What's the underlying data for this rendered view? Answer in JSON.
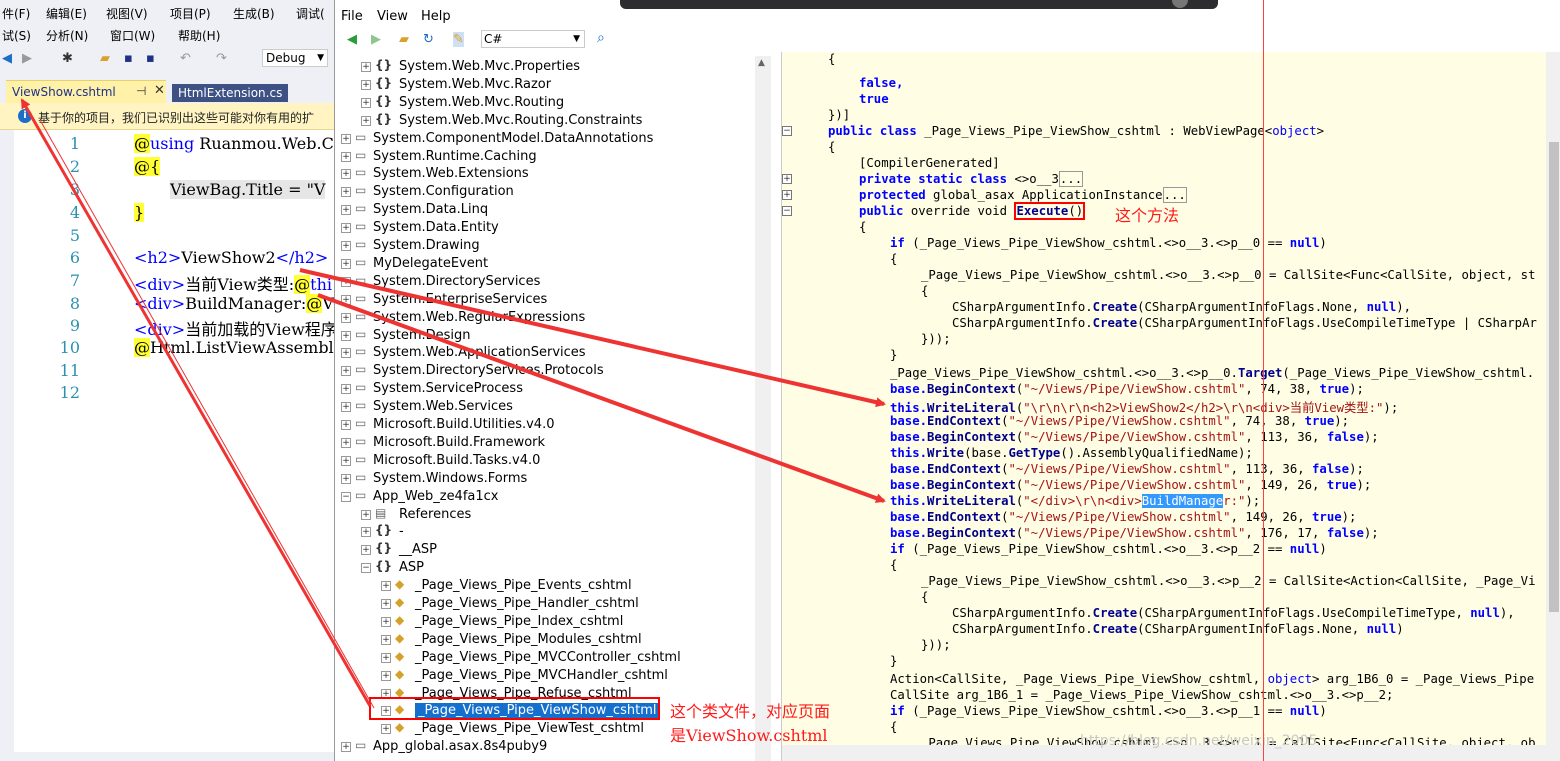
{
  "vs": {
    "menu_row1": [
      "件(F)",
      "编辑(E)",
      "视图(V)",
      "项目(P)",
      "生成(B)",
      "调试("
    ],
    "menu_row2": [
      "试(S)",
      "分析(N)",
      "窗口(W)",
      "帮助(H)"
    ],
    "config": "Debug",
    "tabs": [
      {
        "label": "ViewShow.cshtml",
        "active": true
      },
      {
        "label": "HtmlExtension.cs",
        "active": false
      }
    ],
    "infobar_text": "基于你的项目，我们已识别出这些可能对你有用的扩",
    "line_numbers": [
      "1",
      "2",
      "3",
      "4",
      "5",
      "6",
      "7",
      "8",
      "9",
      "10",
      "11",
      "12"
    ],
    "code": {
      "l1a": "@",
      "l1b": "using",
      "l1c": " Ruanmou.Web.Cor",
      "l2a": "@",
      "l2b": "{",
      "l3": "ViewBag.Title = \"V",
      "l4": "}",
      "l6a": "<h2>",
      "l6b": "ViewShow2",
      "l6c": "</h2>",
      "l7a": "<div>",
      "l7b": "当前View类型:",
      "l7c": "@",
      "l7d": "thi",
      "l8a": "<div>",
      "l8b": "BuildManager:",
      "l8c": "@",
      "l8d": "Vie",
      "l9a": "<div>",
      "l9b": "当前加载的View程序",
      "l10a": "@",
      "l10b": "Html.ListViewAssembli"
    }
  },
  "decompiler": {
    "menu": [
      "File",
      "View",
      "Help"
    ],
    "language": "C#",
    "tree": [
      {
        "label": "System.Web.Mvc.Properties",
        "indent": 1,
        "icon": "{}"
      },
      {
        "label": "System.Web.Mvc.Razor",
        "indent": 1,
        "icon": "{}"
      },
      {
        "label": "System.Web.Mvc.Routing",
        "indent": 1,
        "icon": "{}"
      },
      {
        "label": "System.Web.Mvc.Routing.Constraints",
        "indent": 1,
        "icon": "{}"
      },
      {
        "label": "System.ComponentModel.DataAnnotations",
        "indent": 0,
        "icon": "asm"
      },
      {
        "label": "System.Runtime.Caching",
        "indent": 0,
        "icon": "asm"
      },
      {
        "label": "System.Web.Extensions",
        "indent": 0,
        "icon": "asm"
      },
      {
        "label": "System.Configuration",
        "indent": 0,
        "icon": "asm"
      },
      {
        "label": "System.Data.Linq",
        "indent": 0,
        "icon": "asm"
      },
      {
        "label": "System.Data.Entity",
        "indent": 0,
        "icon": "asm"
      },
      {
        "label": "System.Drawing",
        "indent": 0,
        "icon": "asm"
      },
      {
        "label": "MyDelegateEvent",
        "indent": 0,
        "icon": "asm"
      },
      {
        "label": "System.DirectoryServices",
        "indent": 0,
        "icon": "asm"
      },
      {
        "label": "System.EnterpriseServices",
        "indent": 0,
        "icon": "asm"
      },
      {
        "label": "System.Web.RegularExpressions",
        "indent": 0,
        "icon": "asm"
      },
      {
        "label": "System.Design",
        "indent": 0,
        "icon": "asm"
      },
      {
        "label": "System.Web.ApplicationServices",
        "indent": 0,
        "icon": "asm"
      },
      {
        "label": "System.DirectoryServices.Protocols",
        "indent": 0,
        "icon": "asm"
      },
      {
        "label": "System.ServiceProcess",
        "indent": 0,
        "icon": "asm"
      },
      {
        "label": "System.Web.Services",
        "indent": 0,
        "icon": "asm"
      },
      {
        "label": "Microsoft.Build.Utilities.v4.0",
        "indent": 0,
        "icon": "asm"
      },
      {
        "label": "Microsoft.Build.Framework",
        "indent": 0,
        "icon": "asm"
      },
      {
        "label": "Microsoft.Build.Tasks.v4.0",
        "indent": 0,
        "icon": "asm"
      },
      {
        "label": "System.Windows.Forms",
        "indent": 0,
        "icon": "asm"
      },
      {
        "label": "App_Web_ze4fa1cx",
        "indent": 0,
        "icon": "asm",
        "expanded": true
      },
      {
        "label": "References",
        "indent": 1,
        "icon": "ref"
      },
      {
        "label": "-",
        "indent": 1,
        "icon": "{}"
      },
      {
        "label": "__ASP",
        "indent": 1,
        "icon": "{}"
      },
      {
        "label": "ASP",
        "indent": 1,
        "icon": "{}",
        "expanded": true
      },
      {
        "label": "_Page_Views_Pipe_Events_cshtml",
        "indent": 2,
        "icon": "cls"
      },
      {
        "label": "_Page_Views_Pipe_Handler_cshtml",
        "indent": 2,
        "icon": "cls"
      },
      {
        "label": "_Page_Views_Pipe_Index_cshtml",
        "indent": 2,
        "icon": "cls"
      },
      {
        "label": "_Page_Views_Pipe_Modules_cshtml",
        "indent": 2,
        "icon": "cls"
      },
      {
        "label": "_Page_Views_Pipe_MVCController_cshtml",
        "indent": 2,
        "icon": "cls"
      },
      {
        "label": "_Page_Views_Pipe_MVCHandler_cshtml",
        "indent": 2,
        "icon": "cls"
      },
      {
        "label": "_Page_Views_Pipe_Refuse_cshtml",
        "indent": 2,
        "icon": "cls"
      },
      {
        "label": "_Page_Views_Pipe_ViewShow_cshtml",
        "indent": 2,
        "icon": "cls",
        "selected": true
      },
      {
        "label": "_Page_Views_Pipe_ViewTest_cshtml",
        "indent": 2,
        "icon": "cls"
      },
      {
        "label": "App_global.asax.8s4puby9",
        "indent": 0,
        "icon": "asm"
      }
    ],
    "code": {
      "c1": "{",
      "c2": "false,",
      "c3": "true",
      "c4": "})]",
      "c5a": "public class",
      "c5b": " _Page_Views_Pipe_ViewShow_cshtml : WebViewPage<",
      "c5c": "object",
      "c5d": ">",
      "c6": "{",
      "c7": "[CompilerGenerated]",
      "c8a": "private static class",
      "c8b": " <>o__3",
      "c8c": "...",
      "c9a": "protected",
      "c9b": " global_asax ApplicationInstance",
      "c9c": "...",
      "c10a": "public",
      "c10b": " override void ",
      "c10c": "Execute",
      "c10d": "()",
      "c11": "{",
      "c12a": "if",
      "c12b": " (_Page_Views_Pipe_ViewShow_cshtml.<>o__3.<>p__0 == ",
      "c12c": "null",
      "c12d": ")",
      "c13": "{",
      "c14": "_Page_Views_Pipe_ViewShow_cshtml.<>o__3.<>p__0 = CallSite<Func<CallSite, object, st",
      "c15": "{",
      "c16a": "CSharpArgumentInfo.",
      "c16b": "Create",
      "c16c": "(CSharpArgumentInfoFlags.None, ",
      "c16d": "null",
      "c16e": "),",
      "c17a": "CSharpArgumentInfo.",
      "c17b": "Create",
      "c17c": "(CSharpArgumentInfoFlags.UseCompileTimeType | CSharpAr",
      "c18": "}));",
      "c19": "}",
      "c20a": "_Page_Views_Pipe_ViewShow_cshtml.<>o__3.<>p__0.",
      "c20b": "Target",
      "c20c": "(_Page_Views_Pipe_ViewShow_cshtml.",
      "c21a": "base.",
      "c21b": "BeginContext",
      "c21c": "(",
      "c21d": "\"~/Views/Pipe/ViewShow.cshtml\"",
      "c21e": ", 74, 38, ",
      "c21f": "true",
      "c21g": ");",
      "c22a": "this.",
      "c22b": "WriteLiteral",
      "c22c": "(",
      "c22d": "\"\\r\\n\\r\\n<h2>ViewShow2</h2>\\r\\n<div>当前View类型:\"",
      "c22e": ");",
      "c23a": "base.",
      "c23b": "EndContext",
      "c23c": "(",
      "c23d": "\"~/Views/Pipe/ViewShow.cshtml\"",
      "c23e": ", 74, 38, ",
      "c23f": "true",
      "c23g": ");",
      "c24a": "base.",
      "c24b": "BeginContext",
      "c24c": "(",
      "c24d": "\"~/Views/Pipe/ViewShow.cshtml\"",
      "c24e": ", 113, 36, ",
      "c24f": "false",
      "c24g": ");",
      "c25a": "this.",
      "c25b": "Write",
      "c25c": "(base.",
      "c25d": "GetType",
      "c25e": "().AssemblyQualifiedName);",
      "c26a": "base.",
      "c26b": "EndContext",
      "c26c": "(",
      "c26d": "\"~/Views/Pipe/ViewShow.cshtml\"",
      "c26e": ", 113, 36, ",
      "c26f": "false",
      "c26g": ");",
      "c27a": "base.",
      "c27b": "BeginContext",
      "c27c": "(",
      "c27d": "\"~/Views/Pipe/ViewShow.cshtml\"",
      "c27e": ", 149, 26, ",
      "c27f": "true",
      "c27g": ");",
      "c28a": "this.",
      "c28b": "WriteLiteral",
      "c28c": "(",
      "c28d": "\"</div>\\r\\n<div>",
      "c28e": "BuildManage",
      "c28f": "r:\"",
      "c28g": ");",
      "c29a": "base.",
      "c29b": "EndContext",
      "c29c": "(",
      "c29d": "\"~/Views/Pipe/ViewShow.cshtml\"",
      "c29e": ", 149, 26, ",
      "c29f": "true",
      "c29g": ");",
      "c30a": "base.",
      "c30b": "BeginContext",
      "c30c": "(",
      "c30d": "\"~/Views/Pipe/ViewShow.cshtml\"",
      "c30e": ", 176, 17, ",
      "c30f": "false",
      "c30g": ");",
      "c31a": "if",
      "c31b": " (_Page_Views_Pipe_ViewShow_cshtml.<>o__3.<>p__2 == ",
      "c31c": "null",
      "c31d": ")",
      "c32": "{",
      "c33": "_Page_Views_Pipe_ViewShow_cshtml.<>o__3.<>p__2 = CallSite<Action<CallSite, _Page_Vi",
      "c34": "{",
      "c35a": "CSharpArgumentInfo.",
      "c35b": "Create",
      "c35c": "(CSharpArgumentInfoFlags.UseCompileTimeType, ",
      "c35d": "null",
      "c35e": "),",
      "c36a": "CSharpArgumentInfo.",
      "c36b": "Create",
      "c36c": "(CSharpArgumentInfoFlags.None, ",
      "c36d": "null",
      "c36e": ")",
      "c37": "}));",
      "c38": "}",
      "c39a": "Action<CallSite, _Page_Views_Pipe_ViewShow_cshtml, ",
      "c39b": "object",
      "c39c": "> arg_1B6_0 = _Page_Views_Pipe",
      "c40": "CallSite arg_1B6_1 = _Page_Views_Pipe_ViewShow_cshtml.<>o__3.<>p__2;",
      "c41a": "if",
      "c41b": " (_Page_Views_Pipe_ViewShow_cshtml.<>o__3.<>p__1 == ",
      "c41c": "null",
      "c41d": ")",
      "c42": "{",
      "c43": "_Page_Views_Pipe_ViewShow_cshtml.<>o__3.<>p__1 = CallSite<Func<CallSite, object, ob"
    },
    "watermark": "https://blog.csdn.net/weixin_2005"
  },
  "annotations": {
    "method_note": "这个方法",
    "class_note_line1": "这个类文件，对应页面",
    "class_note_line2": "是ViewShow.cshtml",
    "arrow_color": "#ee3333"
  }
}
